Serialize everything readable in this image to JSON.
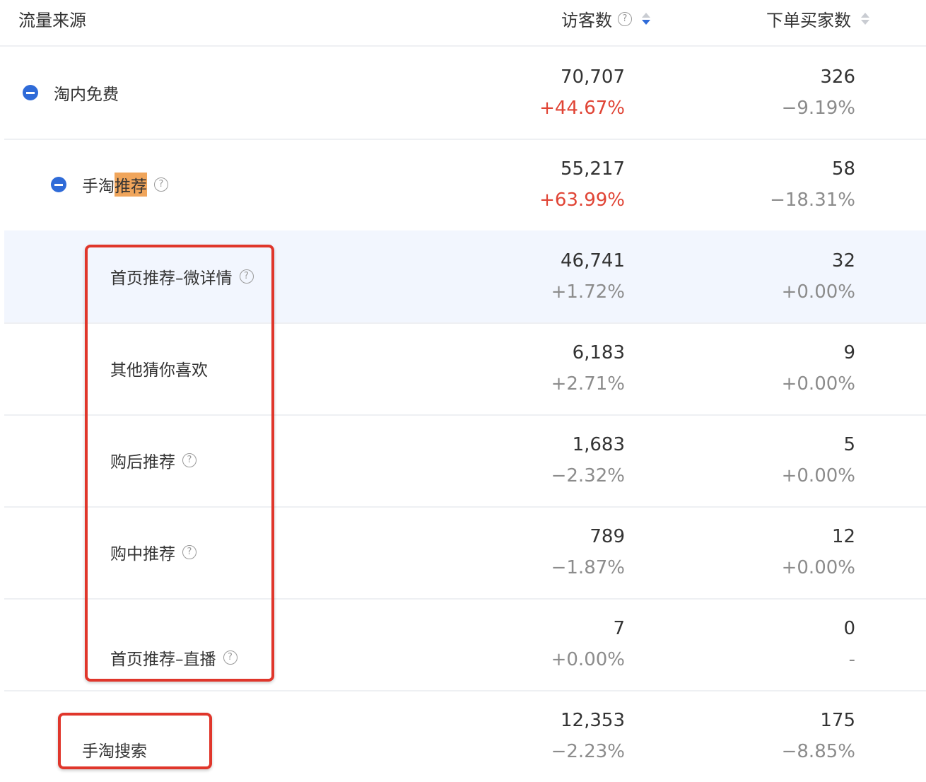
{
  "header": {
    "source_label": "流量来源",
    "visitors_label": "访客数",
    "buyers_label": "下单买家数"
  },
  "icons": {
    "help": "question-circle-icon",
    "sort": "sort-caret-icon",
    "collapse": "minus-circle-icon"
  },
  "colors": {
    "accent": "#2f6bd8",
    "positive_change": "#e04435",
    "highlight": "#f0a55b",
    "annotation_box": "#e0362b"
  },
  "rows": [
    {
      "name": "淘内免费",
      "name_plain": "",
      "visitors": "70,707",
      "visitors_change": "+44.67%",
      "buyers": "326",
      "buyers_change": "−9.19%"
    },
    {
      "name": "手淘",
      "name_highlight": "推荐",
      "visitors": "55,217",
      "visitors_change": "+63.99%",
      "buyers": "58",
      "buyers_change": "−18.31%"
    },
    {
      "name": "首页推荐–微详情",
      "visitors": "46,741",
      "visitors_change": "+1.72%",
      "buyers": "32",
      "buyers_change": "+0.00%"
    },
    {
      "name": "其他猜你喜欢",
      "visitors": "6,183",
      "visitors_change": "+2.71%",
      "buyers": "9",
      "buyers_change": "+0.00%"
    },
    {
      "name": "购后推荐",
      "visitors": "1,683",
      "visitors_change": "−2.32%",
      "buyers": "5",
      "buyers_change": "+0.00%"
    },
    {
      "name": "购中推荐",
      "visitors": "789",
      "visitors_change": "−1.87%",
      "buyers": "12",
      "buyers_change": "+0.00%"
    },
    {
      "name": "首页推荐–直播",
      "visitors": "7",
      "visitors_change": "+0.00%",
      "buyers": "0",
      "buyers_change": "-"
    },
    {
      "name": "手淘搜索",
      "visitors": "12,353",
      "visitors_change": "−2.23%",
      "buyers": "175",
      "buyers_change": "−8.85%"
    }
  ]
}
